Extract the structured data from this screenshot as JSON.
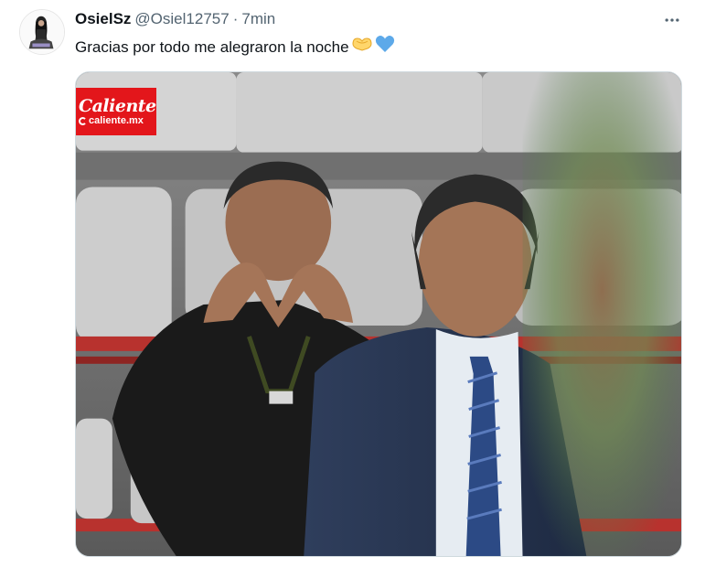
{
  "tweet": {
    "display_name": "OsielSz",
    "handle": "@Osiel12757",
    "separator": "·",
    "time": "7min",
    "text": "Gracias por todo me alegraron la noche",
    "emojis": [
      "yellow-heart-hands-emoji",
      "blue-heart-emoji"
    ]
  },
  "media": {
    "logo_main": "Caliente",
    "logo_sub": "caliente.mx"
  },
  "colors": {
    "text": "#0f1419",
    "secondary": "#536471",
    "border": "#cfd9de",
    "logo_red": "#e3161b",
    "blue_heart": "#5da9e9"
  },
  "icons": {
    "more": "more-horizontal-icon"
  }
}
